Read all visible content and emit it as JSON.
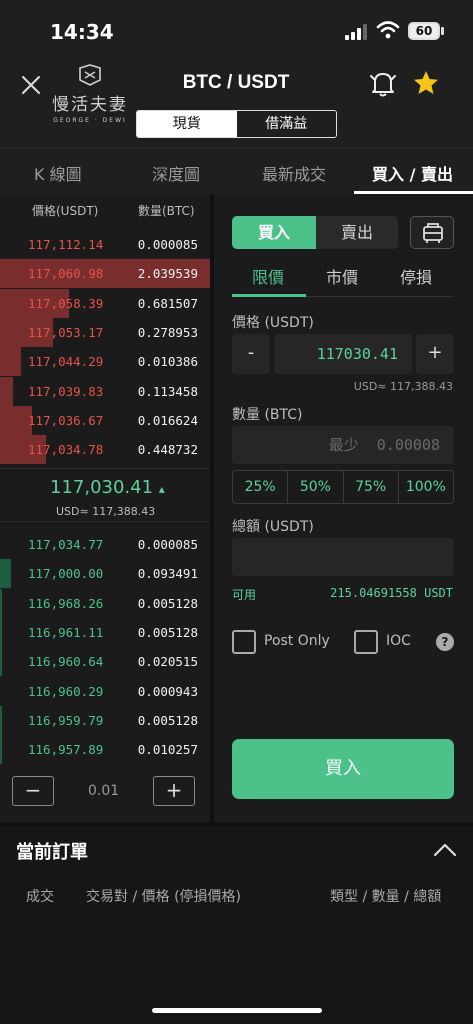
{
  "status": {
    "time": "14:34",
    "battery": "60"
  },
  "header": {
    "logo_zh": "慢活夫妻",
    "logo_en": "GEORGE · DEWI",
    "title": "BTC / USDT",
    "segments": [
      "現貨",
      "借滿益"
    ]
  },
  "tabs": [
    "K 線圖",
    "深度圖",
    "最新成交",
    "買入 / 賣出"
  ],
  "orderbook": {
    "col_price": "價格(USDT)",
    "col_qty": "數量(BTC)",
    "asks": [
      {
        "price": "117,112.14",
        "qty": "0.000085",
        "depth": 0.0
      },
      {
        "price": "117,060.98",
        "qty": "2.039539",
        "depth": 1.0
      },
      {
        "price": "117,058.39",
        "qty": "0.681507",
        "depth": 0.33
      },
      {
        "price": "117,053.17",
        "qty": "0.278953",
        "depth": 0.25
      },
      {
        "price": "117,044.29",
        "qty": "0.010386",
        "depth": 0.1
      },
      {
        "price": "117,039.83",
        "qty": "0.113458",
        "depth": 0.06
      },
      {
        "price": "117,036.67",
        "qty": "0.016624",
        "depth": 0.15
      },
      {
        "price": "117,034.78",
        "qty": "0.448732",
        "depth": 0.22
      }
    ],
    "last_price": "117,030.41",
    "last_price_arrow": "▴",
    "last_usd": "USD≈ 117,388.43",
    "bids": [
      {
        "price": "117,034.77",
        "qty": "0.000085",
        "depth": 0.0
      },
      {
        "price": "117,000.00",
        "qty": "0.093491",
        "depth": 0.05
      },
      {
        "price": "116,968.26",
        "qty": "0.005128",
        "depth": 0.01
      },
      {
        "price": "116,961.11",
        "qty": "0.005128",
        "depth": 0.01
      },
      {
        "price": "116,960.64",
        "qty": "0.020515",
        "depth": 0.01
      },
      {
        "price": "116,960.29",
        "qty": "0.000943",
        "depth": 0.0
      },
      {
        "price": "116,959.79",
        "qty": "0.005128",
        "depth": 0.01
      },
      {
        "price": "116,957.89",
        "qty": "0.010257",
        "depth": 0.01
      }
    ],
    "step_minus": "−",
    "step_value": "0.01",
    "step_plus": "+"
  },
  "form": {
    "buy_label": "買入",
    "sell_label": "賣出",
    "order_types": [
      "限價",
      "市價",
      "停損"
    ],
    "price_label": "價格 (USDT)",
    "price_minus": "-",
    "price_value": "117030.41",
    "price_plus": "+",
    "price_usd": "USD≈ 117,388.43",
    "qty_label": "數量 (BTC)",
    "qty_placeholder": "最少  0.00008",
    "percents": [
      "25%",
      "50%",
      "75%",
      "100%"
    ],
    "total_label": "總額 (USDT)",
    "total_placeholder": "",
    "avail_label": "可用",
    "avail_value": "215.04691558 USDT",
    "post_only": "Post Only",
    "ioc": "IOC",
    "help": "?",
    "submit": "買入"
  },
  "orders": {
    "title": "當前訂單",
    "col_fill": "成交",
    "col_pair": "交易對 / 價格 (停損價格)",
    "col_type": "類型 / 數量 / 總額"
  },
  "colors": {
    "accent": "#4cc28a",
    "ask": "#e5534b",
    "bg": "#1b1b1b"
  }
}
